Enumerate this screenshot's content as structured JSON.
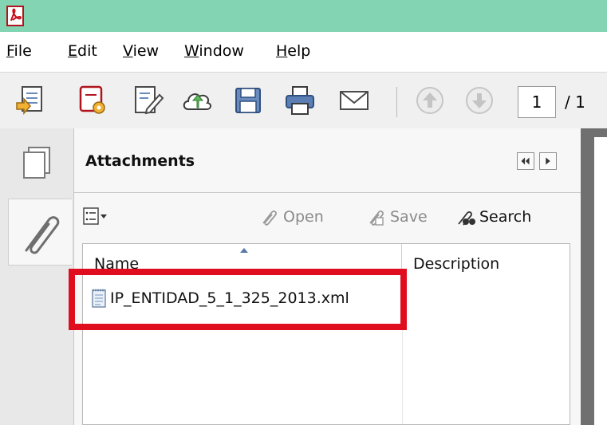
{
  "menu": {
    "file": "File",
    "edit": "Edit",
    "view": "View",
    "window": "Window",
    "help": "Help"
  },
  "toolbar": {
    "page_current": "1",
    "page_total": "/ 1",
    "icons": [
      "create-pdf-icon",
      "convert-icon",
      "sign-icon",
      "cloud-upload-icon",
      "save-icon",
      "print-icon",
      "email-icon",
      "page-up-icon",
      "page-down-icon"
    ]
  },
  "attachments": {
    "title": "Attachments",
    "open_label": "Open",
    "save_label": "Save",
    "search_label": "Search",
    "columns": {
      "name": "Name",
      "description": "Description"
    },
    "files": [
      {
        "name": "IP_ENTIDAD_5_1_325_2013.xml",
        "description": ""
      }
    ]
  },
  "colors": {
    "titlebar": "#82d4b3",
    "highlight": "#e00d1f",
    "toolbar_bg": "#f0f0f0"
  }
}
